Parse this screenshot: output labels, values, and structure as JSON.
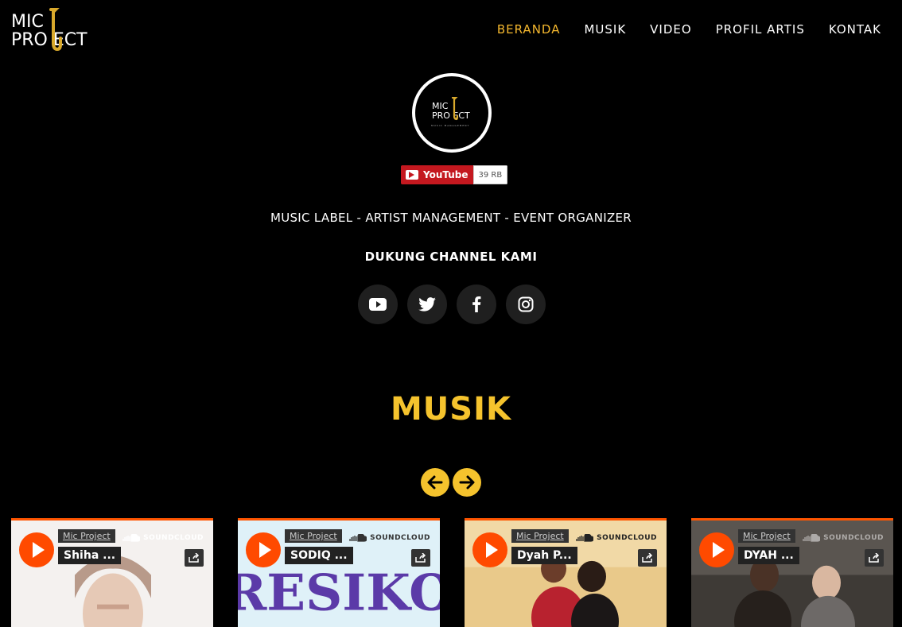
{
  "brand": {
    "logo_line1": "MIC",
    "logo_line2": "PRO  ECT",
    "avatar_line1": "MIC",
    "avatar_line2": "PRO  ECT",
    "avatar_sub": "MUSIC MANAGEMENT",
    "saxophone_icon": "saxophone-icon"
  },
  "nav": {
    "items": [
      {
        "label": "BERANDA",
        "active": true
      },
      {
        "label": "MUSIK",
        "active": false
      },
      {
        "label": "VIDEO",
        "active": false
      },
      {
        "label": "PROFIL ARTIS",
        "active": false
      },
      {
        "label": "KONTAK",
        "active": false
      }
    ]
  },
  "youtube_badge": {
    "label": "YouTube",
    "count": "39 RB"
  },
  "tagline": "MUSIC LABEL - ARTIST MANAGEMENT - EVENT ORGANIZER",
  "support_heading": "DUKUNG CHANNEL KAMI",
  "socials": [
    "youtube-icon",
    "twitter-icon",
    "facebook-icon",
    "instagram-icon"
  ],
  "section_title": "MUSIK",
  "carousel": {
    "prev_icon": "arrow-left-icon",
    "next_icon": "arrow-right-icon"
  },
  "cards": [
    {
      "user": "Mic Project",
      "track": "Shiha ...",
      "provider": "SOUNDCLOUD",
      "art_text": ""
    },
    {
      "user": "Mic Project",
      "track": "SODIQ ...",
      "provider": "SOUNDCLOUD",
      "art_text": "RESIKO"
    },
    {
      "user": "Mic Project",
      "track": "Dyah P...",
      "provider": "SOUNDCLOUD",
      "art_text": ""
    },
    {
      "user": "Mic Project",
      "track": "DYAH ...",
      "provider": "SOUNDCLOUD",
      "art_text": ""
    }
  ],
  "colors": {
    "accent": "#f5c32d",
    "nav_active": "#f5b82e",
    "soundcloud": "#ff5500",
    "background": "#000000",
    "youtube_red": "#c4181f"
  }
}
